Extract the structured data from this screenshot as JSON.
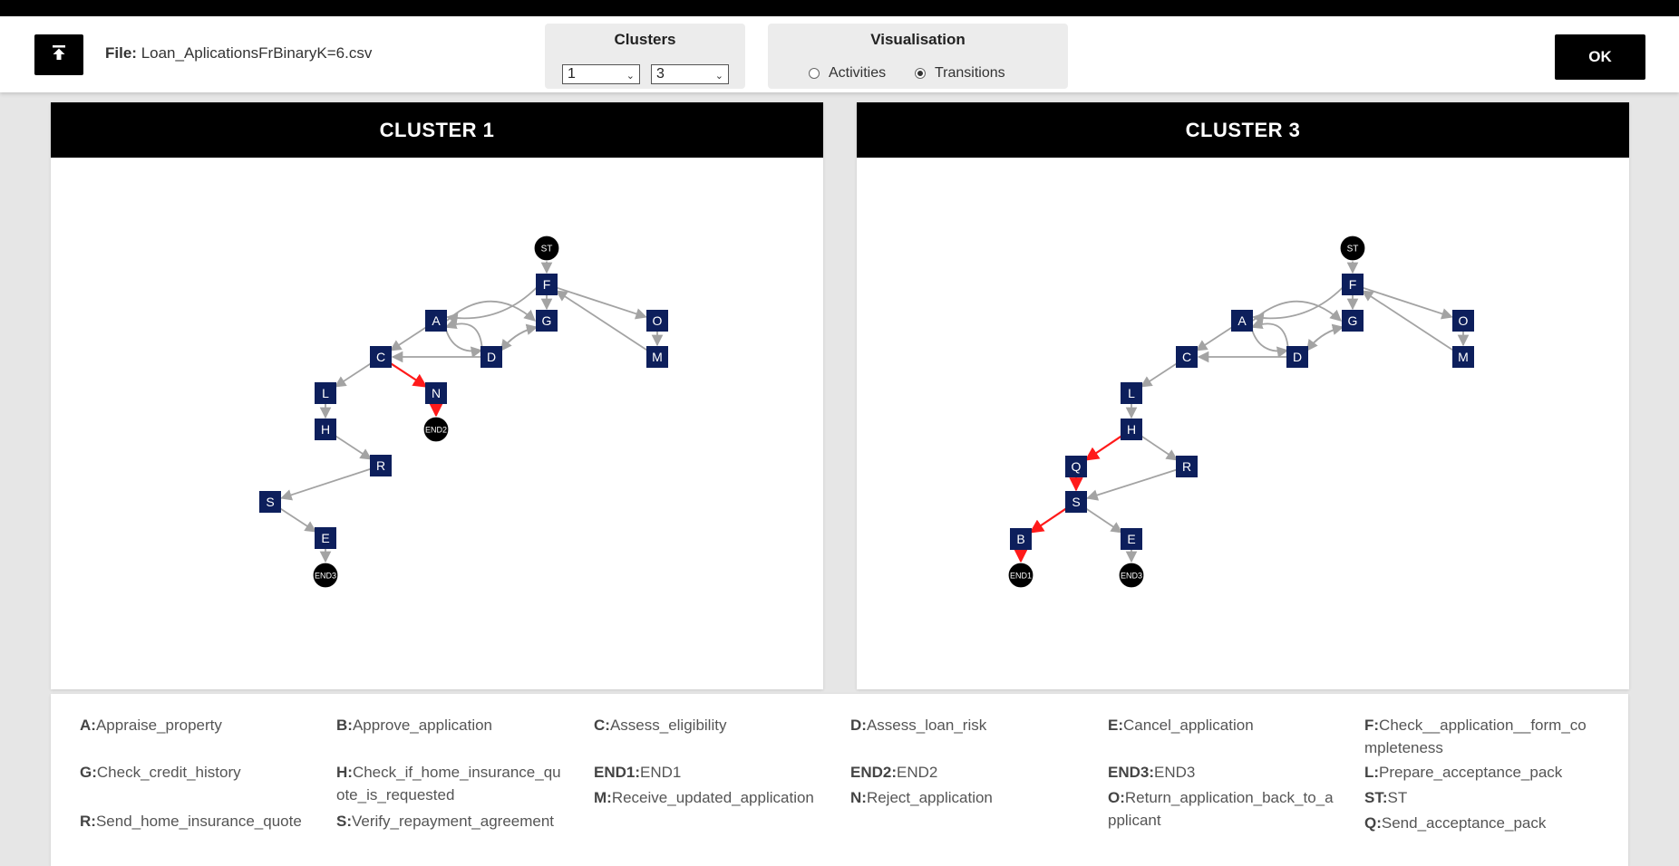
{
  "header": {
    "file_label": "File:",
    "file_name": "Loan_AplicationsFrBinaryK=6.csv",
    "clusters_title": "Clusters",
    "cluster_select_1": "1",
    "cluster_select_2": "3",
    "visualisation_title": "Visualisation",
    "radio_activities": "Activities",
    "radio_transitions": "Transitions",
    "selected_visualisation": "Transitions",
    "ok_label": "OK"
  },
  "graphs": [
    {
      "title": "CLUSTER 1",
      "nodes": [
        {
          "id": "ST",
          "label": "ST",
          "shape": "circle"
        },
        {
          "id": "F",
          "label": "F",
          "shape": "square"
        },
        {
          "id": "A",
          "label": "A",
          "shape": "square"
        },
        {
          "id": "G",
          "label": "G",
          "shape": "square"
        },
        {
          "id": "O",
          "label": "O",
          "shape": "square"
        },
        {
          "id": "C",
          "label": "C",
          "shape": "square"
        },
        {
          "id": "D",
          "label": "D",
          "shape": "square"
        },
        {
          "id": "M",
          "label": "M",
          "shape": "square"
        },
        {
          "id": "L",
          "label": "L",
          "shape": "square"
        },
        {
          "id": "N",
          "label": "N",
          "shape": "square"
        },
        {
          "id": "H",
          "label": "H",
          "shape": "square"
        },
        {
          "id": "END2",
          "label": "END2",
          "shape": "circle"
        },
        {
          "id": "R",
          "label": "R",
          "shape": "square"
        },
        {
          "id": "S",
          "label": "S",
          "shape": "square"
        },
        {
          "id": "E",
          "label": "E",
          "shape": "square"
        },
        {
          "id": "END3",
          "label": "END3",
          "shape": "circle"
        }
      ],
      "edges": [
        {
          "from": "ST",
          "to": "F",
          "highlight": false
        },
        {
          "from": "F",
          "to": "A",
          "highlight": false
        },
        {
          "from": "F",
          "to": "G",
          "highlight": false
        },
        {
          "from": "F",
          "to": "O",
          "highlight": false
        },
        {
          "from": "A",
          "to": "G",
          "highlight": false
        },
        {
          "from": "A",
          "to": "C",
          "highlight": false
        },
        {
          "from": "A",
          "to": "D",
          "highlight": false
        },
        {
          "from": "G",
          "to": "D",
          "highlight": false
        },
        {
          "from": "D",
          "to": "A",
          "highlight": false
        },
        {
          "from": "D",
          "to": "G",
          "highlight": false
        },
        {
          "from": "D",
          "to": "C",
          "highlight": false
        },
        {
          "from": "O",
          "to": "M",
          "highlight": false
        },
        {
          "from": "M",
          "to": "F",
          "highlight": false
        },
        {
          "from": "C",
          "to": "L",
          "highlight": false
        },
        {
          "from": "C",
          "to": "N",
          "highlight": true
        },
        {
          "from": "N",
          "to": "END2",
          "highlight": true
        },
        {
          "from": "L",
          "to": "H",
          "highlight": false
        },
        {
          "from": "H",
          "to": "R",
          "highlight": false
        },
        {
          "from": "R",
          "to": "S",
          "highlight": false
        },
        {
          "from": "S",
          "to": "E",
          "highlight": false
        },
        {
          "from": "E",
          "to": "END3",
          "highlight": false
        }
      ]
    },
    {
      "title": "CLUSTER 3",
      "nodes": [
        {
          "id": "ST",
          "label": "ST",
          "shape": "circle"
        },
        {
          "id": "F",
          "label": "F",
          "shape": "square"
        },
        {
          "id": "A",
          "label": "A",
          "shape": "square"
        },
        {
          "id": "G",
          "label": "G",
          "shape": "square"
        },
        {
          "id": "O",
          "label": "O",
          "shape": "square"
        },
        {
          "id": "C",
          "label": "C",
          "shape": "square"
        },
        {
          "id": "D",
          "label": "D",
          "shape": "square"
        },
        {
          "id": "M",
          "label": "M",
          "shape": "square"
        },
        {
          "id": "L",
          "label": "L",
          "shape": "square"
        },
        {
          "id": "H",
          "label": "H",
          "shape": "square"
        },
        {
          "id": "Q",
          "label": "Q",
          "shape": "square"
        },
        {
          "id": "R",
          "label": "R",
          "shape": "square"
        },
        {
          "id": "S",
          "label": "S",
          "shape": "square"
        },
        {
          "id": "B",
          "label": "B",
          "shape": "square"
        },
        {
          "id": "E",
          "label": "E",
          "shape": "square"
        },
        {
          "id": "END1",
          "label": "END1",
          "shape": "circle"
        },
        {
          "id": "END3",
          "label": "END3",
          "shape": "circle"
        }
      ],
      "edges": [
        {
          "from": "ST",
          "to": "F",
          "highlight": false
        },
        {
          "from": "F",
          "to": "A",
          "highlight": false
        },
        {
          "from": "F",
          "to": "G",
          "highlight": false
        },
        {
          "from": "F",
          "to": "O",
          "highlight": false
        },
        {
          "from": "A",
          "to": "G",
          "highlight": false
        },
        {
          "from": "A",
          "to": "C",
          "highlight": false
        },
        {
          "from": "A",
          "to": "D",
          "highlight": false
        },
        {
          "from": "G",
          "to": "D",
          "highlight": false
        },
        {
          "from": "D",
          "to": "A",
          "highlight": false
        },
        {
          "from": "D",
          "to": "G",
          "highlight": false
        },
        {
          "from": "D",
          "to": "C",
          "highlight": false
        },
        {
          "from": "O",
          "to": "M",
          "highlight": false
        },
        {
          "from": "M",
          "to": "F",
          "highlight": false
        },
        {
          "from": "C",
          "to": "L",
          "highlight": false
        },
        {
          "from": "L",
          "to": "H",
          "highlight": false
        },
        {
          "from": "H",
          "to": "Q",
          "highlight": true
        },
        {
          "from": "H",
          "to": "R",
          "highlight": false
        },
        {
          "from": "Q",
          "to": "S",
          "highlight": true
        },
        {
          "from": "R",
          "to": "S",
          "highlight": false
        },
        {
          "from": "S",
          "to": "B",
          "highlight": true
        },
        {
          "from": "S",
          "to": "E",
          "highlight": false
        },
        {
          "from": "B",
          "to": "END1",
          "highlight": true
        },
        {
          "from": "E",
          "to": "END3",
          "highlight": false
        }
      ]
    }
  ],
  "legend": [
    {
      "key": "A:",
      "value": "Appraise_property"
    },
    {
      "key": "B:",
      "value": "Approve_application"
    },
    {
      "key": "C:",
      "value": "Assess_eligibility"
    },
    {
      "key": "D:",
      "value": "Assess_loan_risk"
    },
    {
      "key": "E:",
      "value": "Cancel_application"
    },
    {
      "key": "F:",
      "value": "Check__application__form_completeness"
    },
    {
      "key": "G:",
      "value": "Check_credit_history"
    },
    {
      "key": "H:",
      "value": "Check_if_home_insurance_quote_is_requested"
    },
    {
      "key": "END1:",
      "value": "END1"
    },
    {
      "key": "END2:",
      "value": "END2"
    },
    {
      "key": "END3:",
      "value": "END3"
    },
    {
      "key": "L:",
      "value": "Prepare_acceptance_pack"
    },
    {
      "key": "M:",
      "value": "Receive_updated_application"
    },
    {
      "key": "N:",
      "value": "Reject_application"
    },
    {
      "key": "O:",
      "value": "Return_application_back_to_applicant"
    },
    {
      "key": "ST:",
      "value": "ST"
    },
    {
      "key": "Q:",
      "value": "Send_acceptance_pack"
    },
    {
      "key": "R:",
      "value": "Send_home_insurance_quote"
    },
    {
      "key": "S:",
      "value": "Verify_repayment_agreement"
    }
  ],
  "colors": {
    "node_fill": "#0d1f5c",
    "terminal_fill": "#000000",
    "edge": "#a3a3a3",
    "edge_highlight": "#ff1a1a"
  }
}
